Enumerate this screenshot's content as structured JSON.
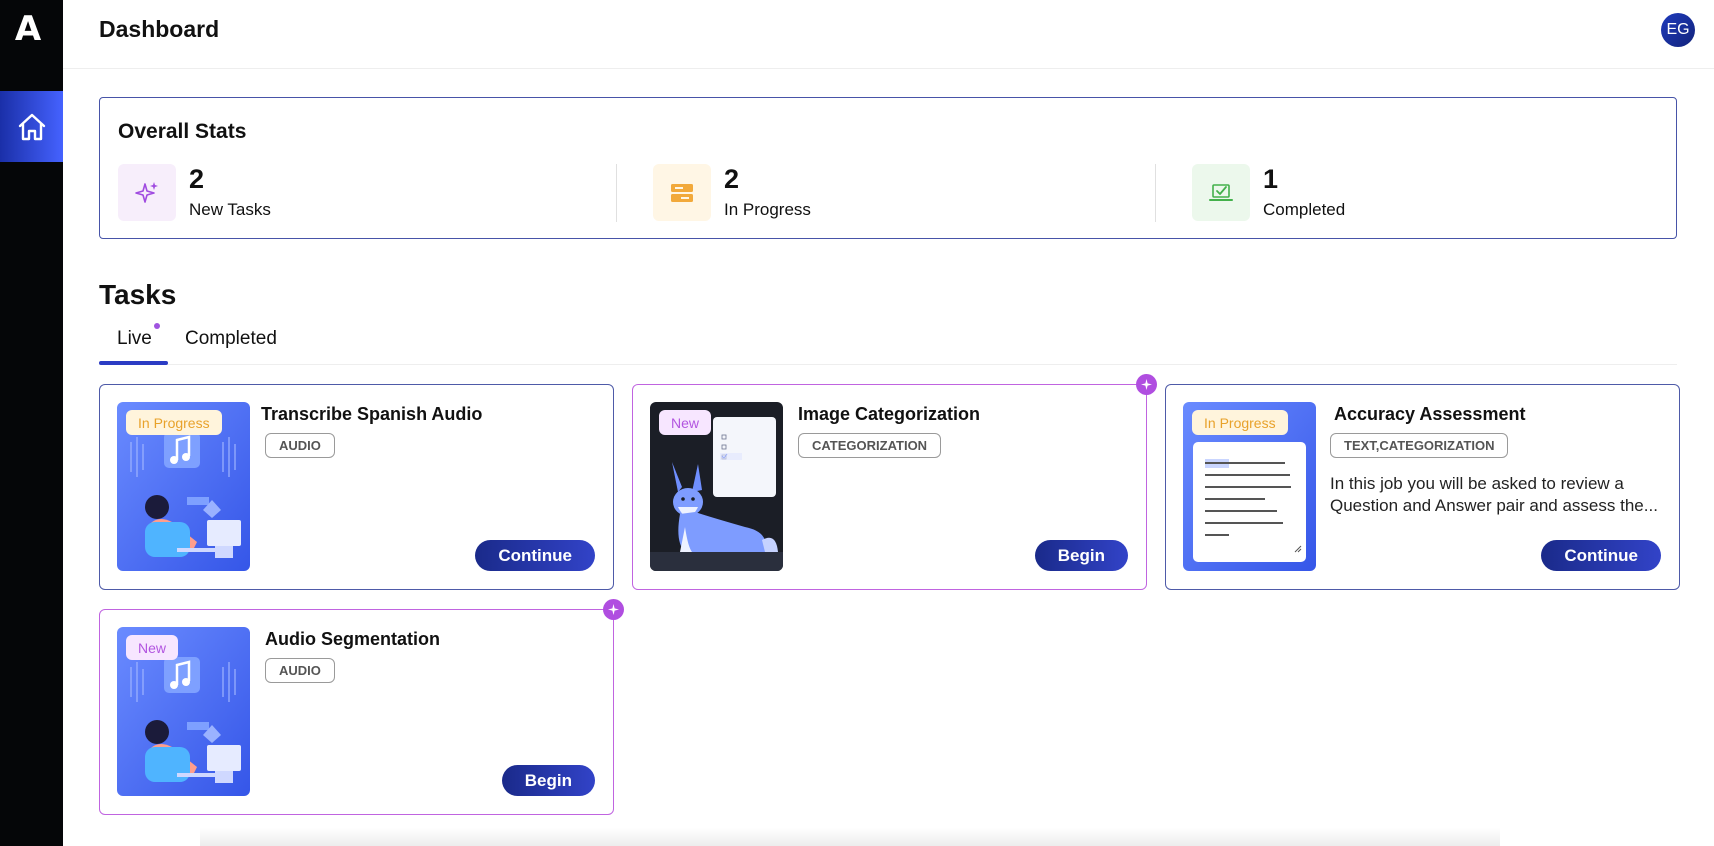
{
  "app": {
    "logo_text": "A",
    "page_title": "Dashboard",
    "avatar_initials": "EG"
  },
  "sidebar": {
    "items": [
      {
        "label": "Home",
        "icon": "home-icon",
        "active": true
      }
    ]
  },
  "stats": {
    "title": "Overall Stats",
    "items": [
      {
        "value": "2",
        "label": "New Tasks",
        "icon": "sparkle-icon",
        "bg": "#f7eefb",
        "color": "#a04be0"
      },
      {
        "value": "2",
        "label": "In Progress",
        "icon": "server-icon",
        "bg": "#fff6e5",
        "color": "#f2a93b"
      },
      {
        "value": "1",
        "label": "Completed",
        "icon": "laptop-check-icon",
        "bg": "#ecf8ec",
        "color": "#43b14b"
      }
    ]
  },
  "tasks": {
    "title": "Tasks",
    "tabs": [
      {
        "label": "Live",
        "active": true
      },
      {
        "label": "Completed",
        "active": false
      }
    ],
    "cards": [
      {
        "title": "Transcribe Spanish Audio",
        "tag": "AUDIO",
        "status": "In Progress",
        "button": "Continue",
        "description": ""
      },
      {
        "title": "Image Categorization",
        "tag": "CATEGORIZATION",
        "status": "New",
        "button": "Begin",
        "description": ""
      },
      {
        "title": "Accuracy Assessment",
        "tag": "TEXT,CATEGORIZATION",
        "status": "In Progress",
        "button": "Continue",
        "description": "In this job you will be asked to review a Question and Answer pair and assess the..."
      },
      {
        "title": "Audio Segmentation",
        "tag": "AUDIO",
        "status": "New",
        "button": "Begin",
        "description": ""
      }
    ]
  },
  "thumbs": {
    "categorization_items": [
      "Animal",
      "Bird",
      "Cat",
      "Dog",
      "Clothes",
      "Food",
      "Furniture"
    ],
    "lorem_text": "Lorem ipsum dolor sit amet consectetur libero fringilla ultricies neque ac turpis. Metus adipiscing et dui donec in id nec enim."
  },
  "colors": {
    "accent": "#2b3cc4",
    "new": "#b04ee0",
    "progress": "#e8a22b",
    "sidebar": "#050608"
  }
}
